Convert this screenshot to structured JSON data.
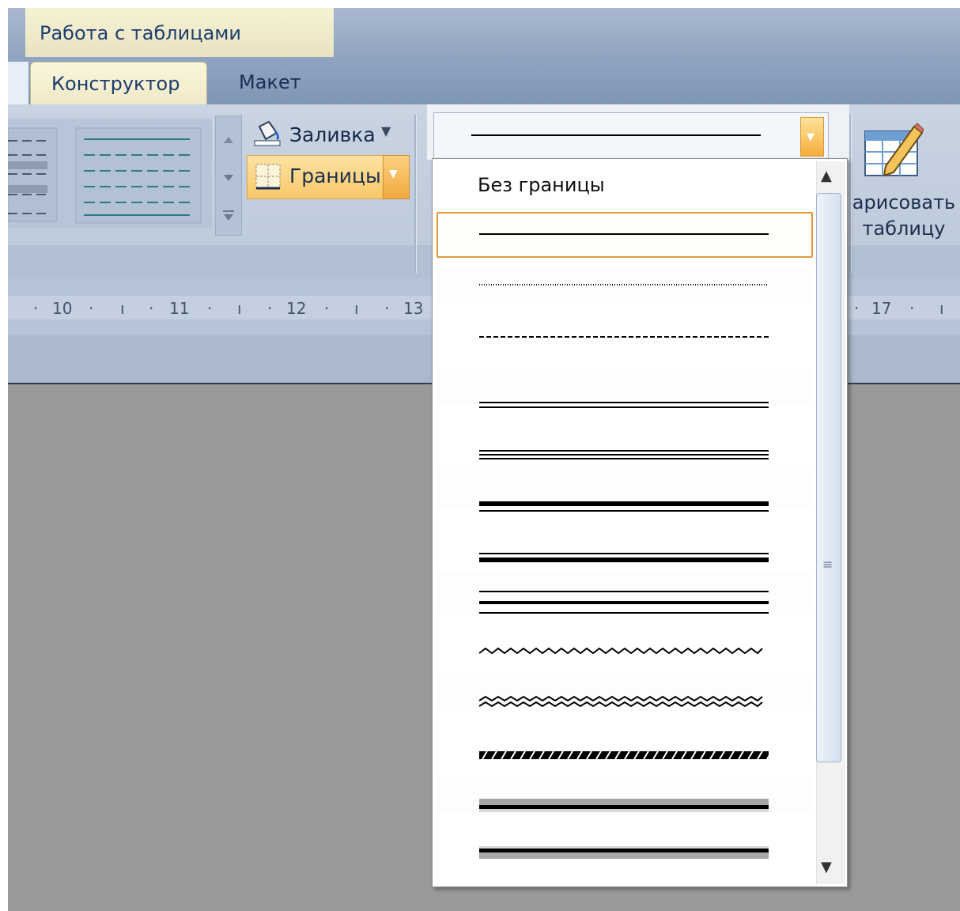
{
  "context_tab": {
    "label": "Работа с таблицами"
  },
  "tabs": [
    {
      "label": "Конструктор",
      "active": true
    },
    {
      "label": "Макет",
      "active": false
    }
  ],
  "ribbon": {
    "fill_label": "Заливка",
    "borders_label": "Границы",
    "draw_table_line1": "арисовать",
    "draw_table_line2": "таблицу"
  },
  "ruler": {
    "ticks": [
      "10",
      "11",
      "12",
      "13",
      "17"
    ]
  },
  "line_style_dropdown": {
    "selected": "single",
    "no_border_label": "Без границы",
    "options": [
      "single",
      "dotted",
      "dashed",
      "double",
      "triple",
      "thick-thin",
      "thin-thick",
      "thin-thick-thin",
      "wavy",
      "double-wavy",
      "dash-dot-stroked",
      "3d-emboss",
      "3d-engrave"
    ]
  },
  "colors": {
    "accent_orange": "#f4ad3c",
    "ribbon_blue": "#bcc9da",
    "context_tab_yellow": "#f7f2d4",
    "document_gray": "#9a9a9a"
  }
}
